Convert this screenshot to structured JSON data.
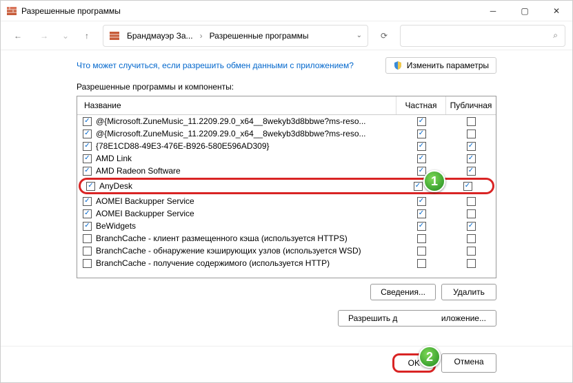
{
  "window": {
    "title": "Разрешенные программы"
  },
  "breadcrumb": {
    "seg1": "Брандмауэр За...",
    "seg2": "Разрешенные программы"
  },
  "help_link": "Что может случиться, если разрешить обмен данными с приложением?",
  "change_settings": "Изменить параметры",
  "section_label": "Разрешенные программы и компоненты:",
  "cols": {
    "name": "Название",
    "private": "Частная",
    "public": "Публичная"
  },
  "rows": [
    {
      "enabled": true,
      "label": "@{Microsoft.ZuneMusic_11.2209.29.0_x64__8wekyb3d8bbwe?ms-reso...",
      "private": true,
      "public": false,
      "highlight": false
    },
    {
      "enabled": true,
      "label": "@{Microsoft.ZuneMusic_11.2209.29.0_x64__8wekyb3d8bbwe?ms-reso...",
      "private": true,
      "public": false,
      "highlight": false
    },
    {
      "enabled": true,
      "label": "{78E1CD88-49E3-476E-B926-580E596AD309}",
      "private": true,
      "public": true,
      "highlight": false
    },
    {
      "enabled": true,
      "label": "AMD Link",
      "private": true,
      "public": true,
      "highlight": false
    },
    {
      "enabled": true,
      "label": "AMD Radeon Software",
      "private": true,
      "public": true,
      "highlight": false
    },
    {
      "enabled": true,
      "label": "AnyDesk",
      "private": true,
      "public": true,
      "highlight": true
    },
    {
      "enabled": true,
      "label": "AOMEI Backupper Service",
      "private": true,
      "public": false,
      "highlight": false
    },
    {
      "enabled": true,
      "label": "AOMEI Backupper Service",
      "private": true,
      "public": false,
      "highlight": false
    },
    {
      "enabled": true,
      "label": "BeWidgets",
      "private": true,
      "public": true,
      "highlight": false
    },
    {
      "enabled": false,
      "label": "BranchCache - клиент размещенного кэша (используется HTTPS)",
      "private": false,
      "public": false,
      "highlight": false
    },
    {
      "enabled": false,
      "label": "BranchCache - обнаружение кэширующих узлов (используется WSD)",
      "private": false,
      "public": false,
      "highlight": false
    },
    {
      "enabled": false,
      "label": "BranchCache - получение содержимого (используется HTTP)",
      "private": false,
      "public": false,
      "highlight": false
    }
  ],
  "buttons": {
    "details": "Сведения...",
    "delete": "Удалить",
    "allow_another_left": "Разрешить д",
    "allow_another_right": "иложение...",
    "ok": "OK",
    "cancel": "Отмена"
  },
  "markers": {
    "one": "1",
    "two": "2"
  }
}
